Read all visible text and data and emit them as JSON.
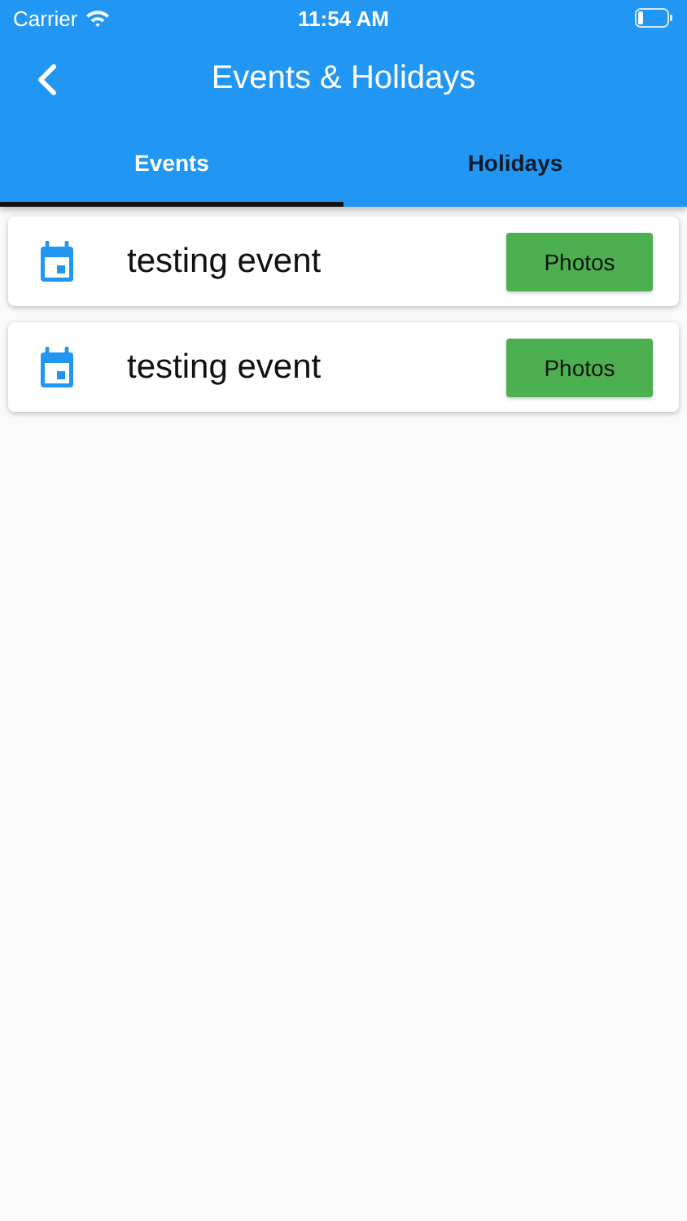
{
  "status_bar": {
    "carrier": "Carrier",
    "time": "11:54 AM"
  },
  "app_bar": {
    "title": "Events & Holidays"
  },
  "tabs": [
    {
      "label": "Events",
      "selected": true
    },
    {
      "label": "Holidays",
      "selected": false
    }
  ],
  "events": [
    {
      "title": "testing event",
      "button": "Photos"
    },
    {
      "title": "testing event",
      "button": "Photos"
    }
  ]
}
